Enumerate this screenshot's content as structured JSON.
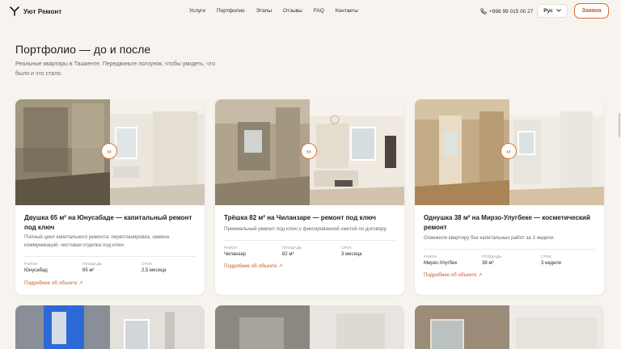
{
  "header": {
    "brand": "Уют Ремонт",
    "nav": [
      "Услуги",
      "Портфолио",
      "Этапы",
      "Отзывы",
      "FAQ",
      "Контакты"
    ],
    "phone": "+998 99 015 00 27",
    "lang": "Рус",
    "cta": "Заявка"
  },
  "hero": {
    "title": "Портфолио — до и после",
    "subtitle": "Реальные квартиры в Ташкенте. Передвиньте ползунок, чтобы увидеть, что было и что стало."
  },
  "labels": {
    "district": "РАЙОН",
    "area": "ПЛОЩАДЬ",
    "term": "СРОК",
    "more": "Подробнее об объекте ↗"
  },
  "cards": [
    {
      "title": "Двушка 65 м² на Юнусабаде — капитальный ремонт под ключ",
      "desc": "Полный цикл капитального ремонта: перепланировка, замена коммуникаций, чистовая отделка под ключ.",
      "district": "Юнусабад",
      "area": "65 м²",
      "term": "2,5 месяца"
    },
    {
      "title": "Трёшка 82 м² на Чиланзаре — ремонт под ключ",
      "desc": "Премиальный ремонт под ключ с фиксированной сметой по договору.",
      "district": "Чиланзар",
      "area": "82 м²",
      "term": "3 месяца"
    },
    {
      "title": "Однушка 38 м² на Мирзо-Улугбеке — косметический ремонт",
      "desc": "Освежили квартиру без капитальных работ за 3 недели.",
      "district": "Мирзо-Улугбек",
      "area": "38 м²",
      "term": "3 недели"
    }
  ],
  "colors": {
    "accent": "#c95c27",
    "background": "#f7f4ef"
  }
}
